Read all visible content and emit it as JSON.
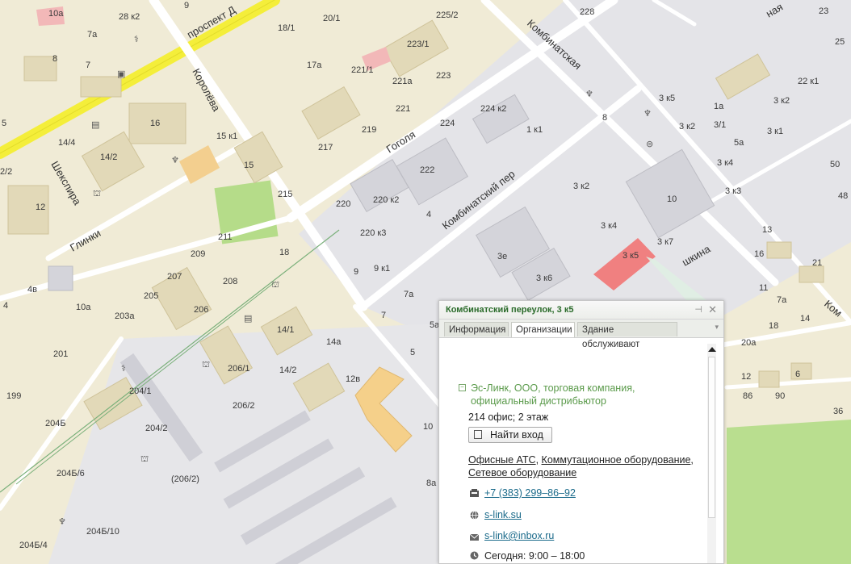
{
  "map": {
    "streets": {
      "prospect": "проспект Д",
      "koroleva": "Королёва",
      "shekspira": "Шекспира",
      "glinki": "Глинки",
      "gogolya": "Гоголя",
      "kombinatskaya": "Комбинатская",
      "kombinatsky_per": "Комбинатский пер",
      "shkina": "шкина",
      "naya": "ная",
      "kom": "Ком"
    },
    "house_labels": [
      "10а",
      "9",
      "28 к2",
      "7а",
      "8",
      "7",
      "5",
      "2/2",
      "14/4",
      "14/2",
      "12",
      "16",
      "15 к1",
      "15",
      "215",
      "217",
      "219",
      "20/1",
      "18/1",
      "17а",
      "221/1",
      "221а",
      "221",
      "223",
      "223/1",
      "225/2",
      "228",
      "224 к2",
      "224",
      "222",
      "220",
      "220 к2",
      "220 к3",
      "4",
      "9 к1",
      "9",
      "18",
      "211",
      "209",
      "207",
      "208",
      "205",
      "206",
      "203а",
      "10а",
      "4в",
      "4",
      "201",
      "199",
      "204/1",
      "206/1",
      "206/2",
      "204/2",
      "204Б",
      "204Б/6",
      "(206/2)",
      "204Б/10",
      "204Б/4",
      "14/1",
      "14/2",
      "14а",
      "12в",
      "10",
      "7а",
      "7",
      "5",
      "5а",
      "8а",
      "3е",
      "3 к6",
      "3 к4",
      "3 к2",
      "3 к5",
      "3 к7",
      "1 к1",
      "8",
      "3 к5",
      "1а",
      "3 к2",
      "3/1",
      "3 к1",
      "5а",
      "3 к4",
      "3 к3",
      "10",
      "3 к2",
      "22 к1",
      "13",
      "16",
      "21",
      "11",
      "7а",
      "18",
      "14",
      "20а",
      "12",
      "86",
      "90",
      "6",
      "50",
      "48",
      "36",
      "23",
      "25"
    ]
  },
  "colors": {
    "background": "#f0ebd6",
    "road": "#ffffff",
    "industrial": "#e4e4e8",
    "highlight": "#f08080",
    "park": "#b9de8f",
    "main_road": "#f4ee3a",
    "popup_title": "#2a6b2a"
  },
  "popup": {
    "title": "Комбинатский переулок, 3 к5",
    "pin_icon": "pin-icon",
    "close_icon": "close-icon",
    "tabs": [
      {
        "label": "Информация"
      },
      {
        "label": "Организации"
      },
      {
        "label": "Здание обслуживают"
      }
    ],
    "active_tab": "Организации",
    "org": {
      "name": "Эс-Линк, ООО, торговая компания, официальный дистрибьютор",
      "office": "214 офис; 2 этаж",
      "find_button": "Найти вход",
      "categories": [
        "Офисные АТС",
        "Коммутационное оборудование",
        "Сетевое оборудование"
      ],
      "phone": "+7 (383) 299–86–92",
      "site": "s-link.su",
      "email": "s-link@inbox.ru",
      "hours": "Сегодня: 9:00 – 18:00"
    }
  }
}
